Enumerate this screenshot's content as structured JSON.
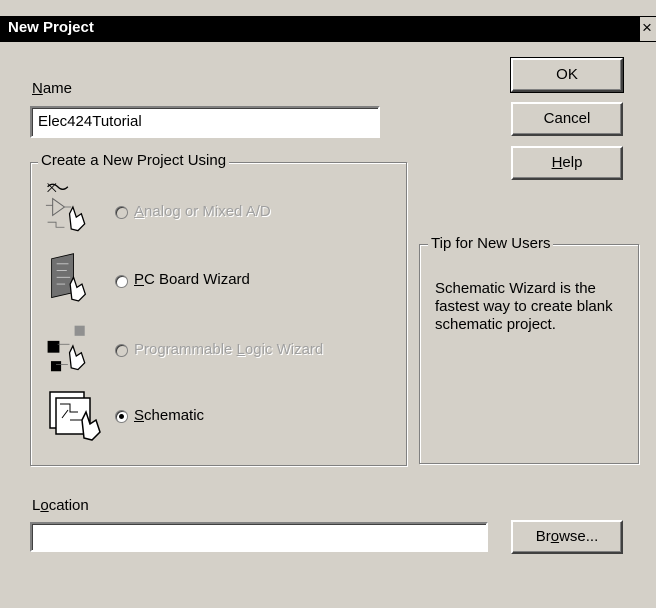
{
  "window": {
    "title": "New Project",
    "close": "×"
  },
  "name_field": {
    "label_accel": "N",
    "label_rest": "ame",
    "value": "Elec424Tutorial"
  },
  "buttons": {
    "ok": "OK",
    "cancel": "Cancel",
    "help_accel": "H",
    "help_rest": "elp",
    "browse_pre": "Br",
    "browse_accel": "o",
    "browse_rest": "wse..."
  },
  "create_group": {
    "title": "Create a New Project Using",
    "options": [
      {
        "accel": "A",
        "rest": "nalog or Mixed A/D",
        "enabled": false,
        "selected": false,
        "icon": "analog-icon"
      },
      {
        "accel": "P",
        "rest": "C Board Wizard",
        "enabled": true,
        "selected": false,
        "icon": "pcb-board-icon"
      },
      {
        "pre": "Programmable ",
        "accel": "L",
        "rest": "ogic Wizard",
        "enabled": false,
        "selected": false,
        "icon": "programmable-logic-icon"
      },
      {
        "accel": "S",
        "rest": "chematic",
        "enabled": true,
        "selected": true,
        "icon": "schematic-icon"
      }
    ]
  },
  "tip_group": {
    "title": "Tip for New Users",
    "text": "Schematic Wizard is the fastest way to create blank schematic project."
  },
  "location_field": {
    "label_pre": "L",
    "label_accel": "o",
    "label_rest": "cation",
    "value": ""
  }
}
